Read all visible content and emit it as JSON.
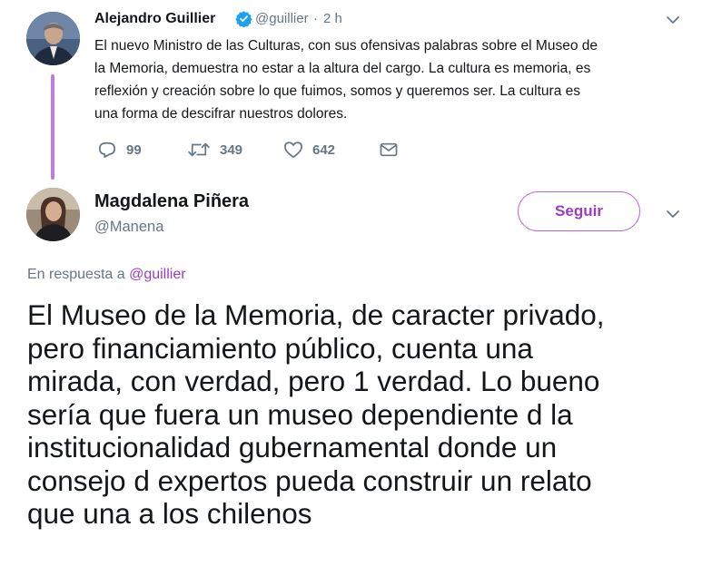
{
  "parent_tweet": {
    "author_name": "Alejandro Guillier",
    "author_handle": "@guillier",
    "separator": "·",
    "time": "2 h",
    "text_lines": [
      "El nuevo Ministro de las Culturas, con sus ofensivas palabras sobre el Museo de",
      "la Memoria, demuestra no estar a la altura del cargo. La cultura es memoria, es",
      "reflexión y creación sobre lo que fuimos, somos y queremos ser. La cultura es",
      "una forma de descifrar nuestros dolores."
    ],
    "reply_count": "99",
    "retweet_count": "349",
    "like_count": "642"
  },
  "main_tweet": {
    "author_name": "Magdalena Piñera",
    "author_handle": "@Manena",
    "follow_label": "Seguir",
    "reply_prefix": "En respuesta a",
    "reply_handle": "@guillier",
    "text_lines": [
      "El Museo de la Memoria, de caracter privado,",
      "pero financiamiento público,  cuenta una",
      "mirada, con verdad, pero 1 verdad. Lo bueno",
      "sería que fuera un museo dependiente d la",
      "institucionalidad gubernamental donde un",
      "consejo d expertos pueda construir un relato",
      "que una a los chilenos"
    ]
  },
  "icons": {
    "verified": "verified-badge-icon",
    "caret": "chevron-down-icon",
    "reply": "reply-icon",
    "retweet": "retweet-icon",
    "like": "heart-icon",
    "message": "envelope-icon"
  },
  "colors": {
    "accent": "#9c3cc6",
    "thread_line": "#c27ce0",
    "verified": "#1da1f2",
    "muted": "#657786",
    "text": "#14171a"
  }
}
